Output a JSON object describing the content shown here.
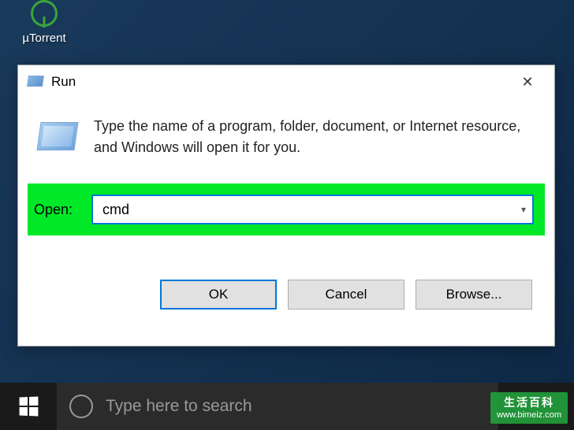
{
  "desktop": {
    "icon_label": "µTorrent"
  },
  "run_dialog": {
    "title": "Run",
    "description": "Type the name of a program, folder, document, or Internet resource, and Windows will open it for you.",
    "open_label": "Open:",
    "open_value": "cmd",
    "buttons": {
      "ok": "OK",
      "cancel": "Cancel",
      "browse": "Browse..."
    }
  },
  "taskbar": {
    "search_placeholder": "Type here to search"
  },
  "watermark": {
    "title": "生活百科",
    "url": "www.bimeiz.com"
  }
}
